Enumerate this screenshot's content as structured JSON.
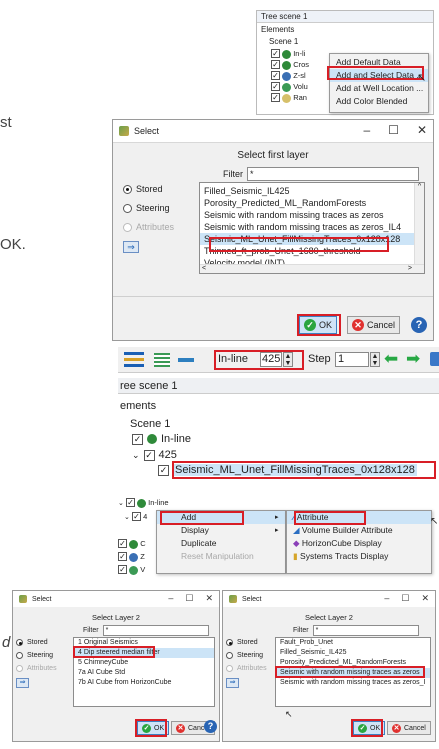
{
  "fragments": {
    "st": "st",
    "k": "OK.",
    "d": "d"
  },
  "tree_menu": {
    "title": "Tree scene 1",
    "elements_label": "Elements",
    "scene_label": "Scene 1",
    "items": [
      "In-li",
      "Cros",
      "Z-sl",
      "Volu",
      "Ran"
    ],
    "context_menu": [
      "Add Default Data",
      "Add and Select Data ...",
      "Add at Well Location ...",
      "Add Color Blended"
    ]
  },
  "select_first": {
    "window_title": "Select",
    "heading": "Select  first layer",
    "filter_label": "Filter",
    "filter_value": "*",
    "radios": [
      "Stored",
      "Steering",
      "Attributes"
    ],
    "items": [
      "Filled_Seismic_IL425",
      "Porosity_Predicted_ML_RandomForests",
      "Seismic with random missing traces as zeros",
      "Seismic with random missing traces as zeros_IL4",
      "Seismic_ML_Unet_FillMissingTraces_0x128x128",
      "Thinned_ft_prob_Unet_1680_threshold",
      "Velocity model (INT)"
    ],
    "ok_label": "OK",
    "cancel_label": "Cancel",
    "help_label": "?"
  },
  "toolbar": {
    "inline_label": "In-line",
    "inline_value": "425",
    "step_label": "Step",
    "step_value": "1"
  },
  "tree_scene": {
    "title": "ree scene 1",
    "elements_label": "ements",
    "scene_label": "Scene 1",
    "inline_label": "In-line",
    "number_label": "425",
    "child_label": "Seismic_ML_Unet_FillMissingTraces_0x128x128"
  },
  "add_menu": {
    "tree_items": [
      "In-line",
      "4",
      "C",
      "Z",
      "V"
    ],
    "menu_items": [
      "Add",
      "Display",
      "Duplicate",
      "Reset Manipulation"
    ],
    "submenu_items": [
      "Attribute",
      "Volume Builder Attribute",
      "HorizonCube Display",
      "Systems Tracts Display"
    ]
  },
  "select_layer2_left": {
    "window_title": "Select",
    "heading": "Select  Layer 2",
    "filter_label": "Filter",
    "filter_value": "*",
    "radios": [
      "Stored",
      "Steering",
      "Attributes"
    ],
    "items": [
      "1 Original Seismics",
      "4 Dip steered median filter",
      "5 ChimneyCube",
      "7a AI Cube Std",
      "7b AI Cube from HorizonCube"
    ],
    "ok_label": "OK",
    "cancel_label": "Cancel"
  },
  "select_layer2_right": {
    "window_title": "Select",
    "heading": "Select  Layer 2",
    "filter_label": "Filter",
    "filter_value": "*",
    "radios": [
      "Stored",
      "Steering",
      "Attributes"
    ],
    "items": [
      "Fault_Prob_Unet",
      "Filled_Seismic_IL425",
      "Porosity_Predicted_ML_RandomForests",
      "Seismic with random missing traces as zeros",
      "Seismic with random missing traces as zeros_I"
    ],
    "ok_label": "OK",
    "cancel_label": "Cancel"
  }
}
